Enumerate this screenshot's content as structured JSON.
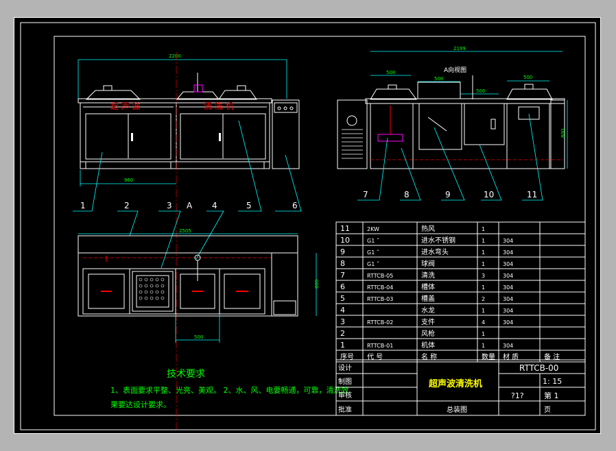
{
  "front_view": {
    "dim_overall": "2200",
    "dim_leg": "960",
    "label_left": "超 声 波",
    "label_right": "清 洗 机",
    "section_mark": "A"
  },
  "side_view": {
    "title": "A向视图",
    "dim_overall": "2199",
    "dim_500_a": "500",
    "dim_500_b": "500",
    "dim_500_c": "500",
    "dim_500_d": "500",
    "dim_height": "800"
  },
  "top_view": {
    "dim_overall": "2505",
    "dim_500": "500",
    "dim_height": "800"
  },
  "balloons": {
    "left": [
      "1",
      "2",
      "3",
      "4",
      "5",
      "6"
    ],
    "right": [
      "7",
      "8",
      "9",
      "10",
      "11"
    ]
  },
  "tech_requirements": {
    "title": "技术要求",
    "line1": "1、表面要求平整、光亮、美观。 2、水、风、电要畅通，可靠，清洗效",
    "line2": "果要达设计要求。"
  },
  "bom": {
    "rows": [
      {
        "no": "11",
        "code": "2KW",
        "name": "热风",
        "qty": "1",
        "mat": ""
      },
      {
        "no": "10",
        "code": "G1 ˝",
        "name": "进水不锈钢",
        "qty": "1",
        "mat": "304"
      },
      {
        "no": "9",
        "code": "G1 ˝",
        "name": "进水弯头",
        "qty": "1",
        "mat": "304"
      },
      {
        "no": "8",
        "code": "G1 ˝",
        "name": "球阀",
        "qty": "1",
        "mat": "304"
      },
      {
        "no": "7",
        "code": "RTTCB-05",
        "name": "清洗",
        "qty": "3",
        "mat": "304"
      },
      {
        "no": "6",
        "code": "RTTCB-04",
        "name": "槽体",
        "qty": "1",
        "mat": "304"
      },
      {
        "no": "5",
        "code": "RTTCB-03",
        "name": "槽盖",
        "qty": "2",
        "mat": "304"
      },
      {
        "no": "4",
        "code": "",
        "name": "水龙",
        "qty": "1",
        "mat": "304"
      },
      {
        "no": "3",
        "code": "RTTCB-02",
        "name": "支件",
        "qty": "4",
        "mat": "304"
      },
      {
        "no": "2",
        "code": "",
        "name": "风枪",
        "qty": "1",
        "mat": ""
      },
      {
        "no": "1",
        "code": "RTTCB-01",
        "name": "机体",
        "qty": "1",
        "mat": "304"
      }
    ],
    "header": {
      "no": "序号",
      "code": "代 号",
      "name": "名 称",
      "qty": "数量",
      "mat": "材 质",
      "note": "备 注"
    }
  },
  "title_block": {
    "design": "设计",
    "draw": "制图",
    "check": "审核",
    "approve": "批准",
    "title": "超声波清洗机",
    "drawing_no": "RTTCB-00",
    "scale": "1: 15",
    "weight": "?1?",
    "sheet": "第 1",
    "page": "页",
    "assembly": "总装图"
  },
  "colors": {
    "white": "#ffffff",
    "cyan": "#00ffff",
    "yellow": "#ffff00",
    "green": "#00ff00",
    "red": "#ff0000",
    "magenta": "#ff00ff"
  }
}
